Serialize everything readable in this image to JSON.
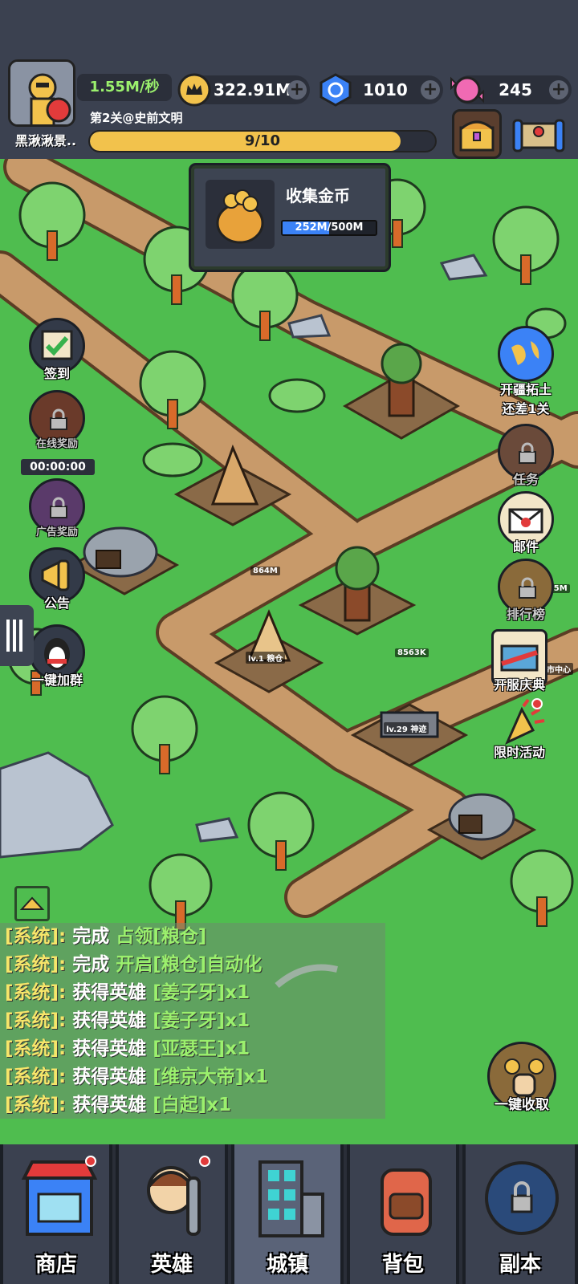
{
  "player": {
    "name": "黑湫湫景..",
    "income_rate": "1.55M/秒"
  },
  "resources": {
    "gold": "322.91M",
    "gems": "1010",
    "candy": "245"
  },
  "level": {
    "label": "第2关@史前文明",
    "progress_text": "9/10",
    "progress_fraction": 0.9
  },
  "collect_panel": {
    "title": "收集金币",
    "progress_text": "252M/500M",
    "progress_fraction": 0.504
  },
  "left_buttons": {
    "checkin": "签到",
    "online_reward": "在线奖励",
    "online_timer": "00:00:00",
    "ad_reward": "广告奖励",
    "announcement": "公告",
    "join_group": "一键加群"
  },
  "right_buttons": {
    "expand": "开疆拓土",
    "expand_sub": "还差1关",
    "tasks": "任务",
    "mail": "邮件",
    "leaderboard": "排行榜",
    "server_celebration": "开服庆典",
    "limited_event": "限时活动",
    "harvest_all": "一键收取"
  },
  "buildings": {
    "granary_level": "lv.1",
    "granary_name": "粮仓",
    "shrine_level": "lv.29",
    "shrine_name": "神迹",
    "badge_1": "864M",
    "badge_2": "8563K",
    "badge_3": "7.5M",
    "market": "市中心"
  },
  "chat": [
    {
      "tag": "[系统]:",
      "act": "完成",
      "obj": "占领[粮仓]"
    },
    {
      "tag": "[系统]:",
      "act": "完成",
      "obj": "开启[粮仓]自动化"
    },
    {
      "tag": "[系统]:",
      "act": "获得英雄",
      "obj": "[姜子牙]x1"
    },
    {
      "tag": "[系统]:",
      "act": "获得英雄",
      "obj": "[姜子牙]x1"
    },
    {
      "tag": "[系统]:",
      "act": "获得英雄",
      "obj": "[亚瑟王]x1"
    },
    {
      "tag": "[系统]:",
      "act": "获得英雄",
      "obj": "[维京大帝]x1"
    },
    {
      "tag": "[系统]:",
      "act": "获得英雄",
      "obj": "[白起]x1"
    }
  ],
  "nav": {
    "shop": "商店",
    "heroes": "英雄",
    "town": "城镇",
    "backpack": "背包",
    "dungeon": "副本",
    "active": "town"
  },
  "colors": {
    "grass": "#4fbd4f",
    "path": "#c89a6a",
    "panel": "#3b4150",
    "gold_bar": "#f2c24c",
    "chat_tag": "#f6e56a",
    "chat_obj": "#9bf06d"
  }
}
